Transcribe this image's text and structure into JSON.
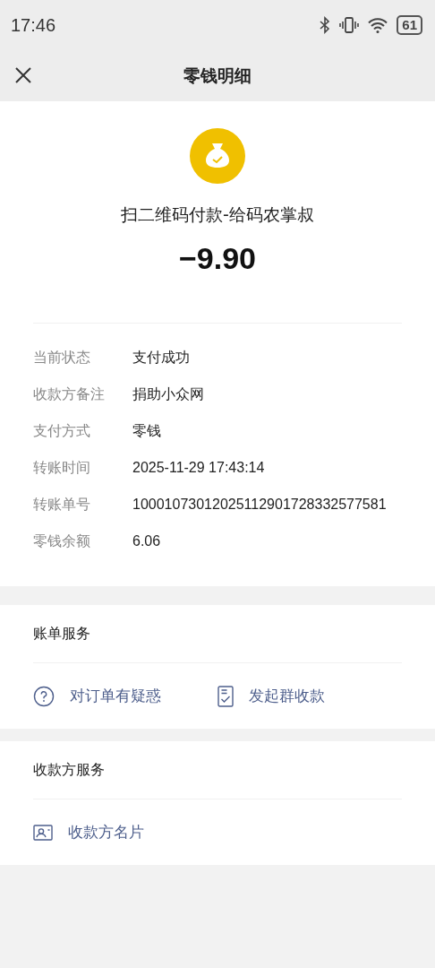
{
  "status_bar": {
    "time": "17:46",
    "battery": "61"
  },
  "nav": {
    "title": "零钱明细"
  },
  "summary": {
    "merchant": "扫二维码付款-给码农掌叔",
    "amount": "−9.90"
  },
  "details": [
    {
      "label": "当前状态",
      "value": "支付成功"
    },
    {
      "label": "收款方备注",
      "value": "捐助小众网"
    },
    {
      "label": "支付方式",
      "value": "零钱"
    },
    {
      "label": "转账时间",
      "value": "2025-11-29 17:43:14"
    },
    {
      "label": "转账单号",
      "value": "10001073012025112901728332577581"
    },
    {
      "label": "零钱余额",
      "value": "6.06"
    }
  ],
  "sections": [
    {
      "title": "账单服务",
      "actions": [
        {
          "kind": "question",
          "label": "对订单有疑惑"
        },
        {
          "kind": "document",
          "label": "发起群收款"
        }
      ]
    },
    {
      "title": "收款方服务",
      "actions": [
        {
          "kind": "card",
          "label": "收款方名片"
        }
      ]
    }
  ]
}
